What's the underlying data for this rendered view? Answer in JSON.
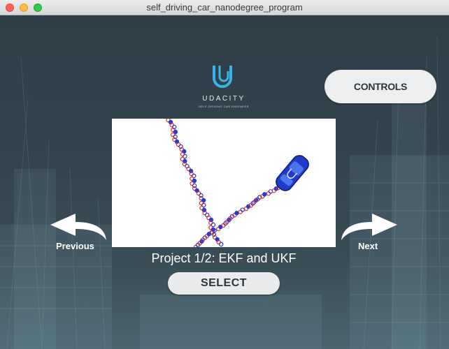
{
  "window": {
    "title": "self_driving_car_nanodegree_program"
  },
  "logo": {
    "name": "UDACITY",
    "tagline": "SELF-DRIVING CAR ENGINEER",
    "color": "#3ab3e6"
  },
  "controls_label": "CONTROLS",
  "preview": {
    "marker_colors": {
      "measurement": "#e8281e",
      "estimate": "#1e3cd8"
    },
    "car_color": "#1f3cc8"
  },
  "nav": {
    "previous_label": "Previous",
    "next_label": "Next"
  },
  "project_title": "Project 1/2: EKF and UKF",
  "select_label": "SELECT"
}
